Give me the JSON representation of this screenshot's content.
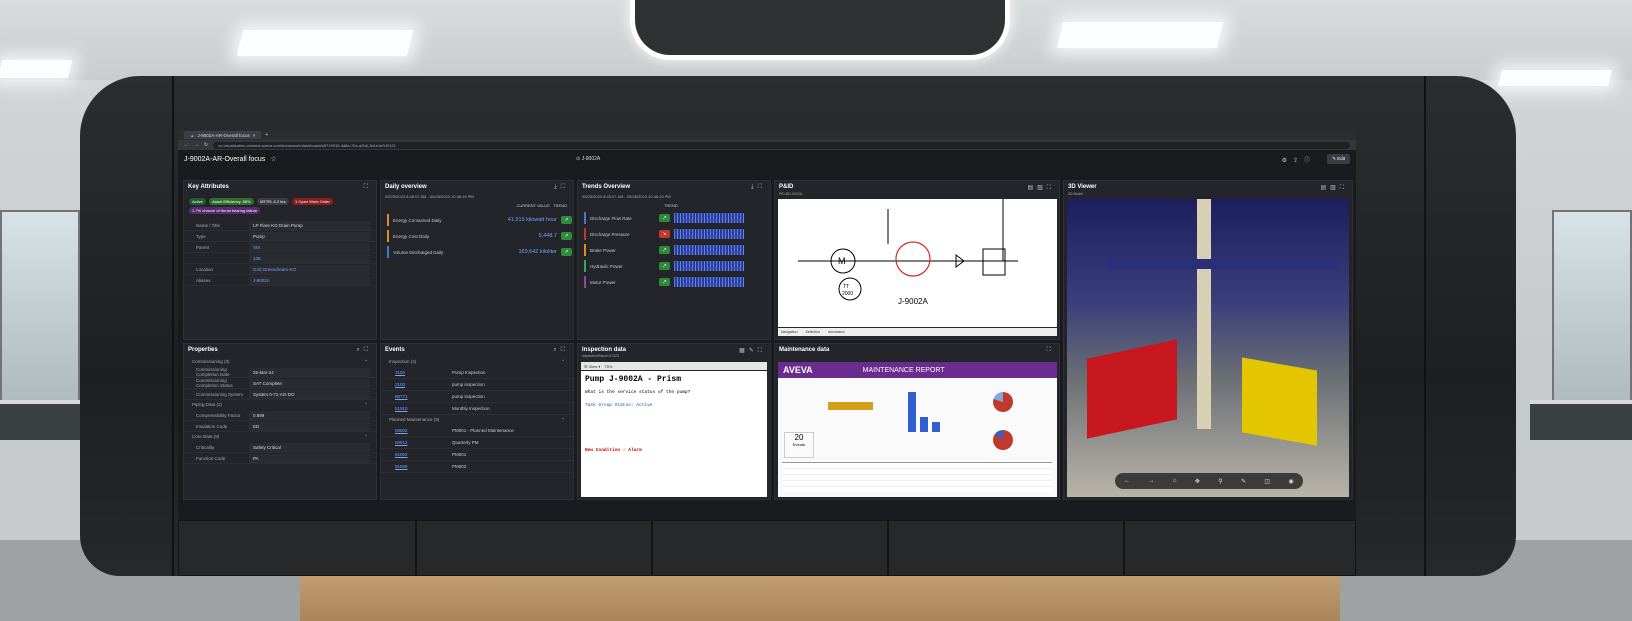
{
  "browser": {
    "tab_title": "J-9002A-AR-Overall focus",
    "url": "vo.visualization.connect.aveva.com/homework/dashboard/a5719910-4d8a-70a-a2b6-3a1e1e049121"
  },
  "header": {
    "title": "J-9002A-AR-Overall focus",
    "center": "J-9002A",
    "edit_label": "Edit",
    "icons": [
      "settings-icon",
      "share-icon",
      "info-icon"
    ]
  },
  "key_attributes": {
    "title": "Key Attributes",
    "badges": [
      "Active",
      "Asset Efficiency: 88%",
      "MTTR: 4.2 hrs",
      "1 Open Work Order"
    ],
    "warning": "1.7% chance of thrust bearing failure",
    "rows": [
      {
        "k": "Name / Title",
        "v": "LP Flare KO Drain Pump"
      },
      {
        "k": "Type",
        "v": "Pump"
      },
      {
        "k": "Parent",
        "v": "SM"
      },
      {
        "k": "",
        "v": "136"
      },
      {
        "k": "Location",
        "v": "Grid Greendream-KO"
      },
      {
        "k": "Aliases",
        "v": "J-9002A"
      }
    ]
  },
  "daily_overview": {
    "title": "Daily overview",
    "range": "05/25/2023 8:45:07 AM - 05/26/2023 10:48:19 PM",
    "col_value": "CURRENT VALUE",
    "col_trend": "TREND",
    "kpis": [
      {
        "label": "Energy Consumed Daily",
        "value": "41,913 kilowatt hour",
        "color": "#e08a2c"
      },
      {
        "label": "Energy Cost Daily",
        "value": "5,448.7",
        "color": "#e08a2c"
      },
      {
        "label": "Volume Discharged Daily",
        "value": "169,642 kiloliter",
        "color": "#3a7bd5"
      }
    ]
  },
  "trends": {
    "title": "Trends Overview",
    "range": "05/25/2023 8:45:07 AM - 05/26/2023 10:48:19 PM",
    "col_trend": "TREND",
    "items": [
      {
        "label": "Discharge Flow Rate",
        "color": "#3a7bd5",
        "status": "up"
      },
      {
        "label": "Discharge Pressure",
        "color": "#c0392b",
        "status": "down"
      },
      {
        "label": "Brake Power",
        "color": "#e08a2c",
        "status": "up"
      },
      {
        "label": "Hydraulic Power",
        "color": "#27ae60",
        "status": "up"
      },
      {
        "label": "Motor Power",
        "color": "#8e44ad",
        "status": "up"
      }
    ]
  },
  "pid": {
    "title": "P&ID",
    "subtitle": "PID-BD-9002A",
    "pump_label": "J-9002A",
    "motor": "M",
    "tag": "TT\n2000",
    "toolbar": [
      "Navigation",
      "Selection",
      "Annotation"
    ]
  },
  "viewer": {
    "title": "3D Viewer",
    "subtitle": "3D Model"
  },
  "properties": {
    "title": "Properties",
    "sections": [
      {
        "name": "Commissioning (3)",
        "rows": [
          {
            "k": "Commissioning Completion Date",
            "v": "25-Mar-24"
          },
          {
            "k": "Commissioning Completion Status",
            "v": "SAT Complete"
          },
          {
            "k": "Commissioning System",
            "v": "System 0-71-AO-DO"
          }
        ]
      },
      {
        "name": "Piping Data (2)",
        "rows": [
          {
            "k": "Compressibility Factor",
            "v": "0.899"
          },
          {
            "k": "Insulation Code",
            "v": "ED"
          }
        ]
      },
      {
        "name": "Core Data (9)",
        "rows": [
          {
            "k": "Criticality",
            "v": "Safety Critical"
          },
          {
            "k": "Function Code",
            "v": "PA"
          }
        ]
      }
    ]
  },
  "events": {
    "title": "Events",
    "sections": [
      {
        "name": "Inspection (4)",
        "items": [
          {
            "id": "3100",
            "label": "Pump Inspection"
          },
          {
            "id": "2100",
            "label": "pump inspection"
          },
          {
            "id": "86771",
            "label": "pump inspection"
          },
          {
            "id": "51910",
            "label": "Monthly Inspection"
          }
        ]
      },
      {
        "name": "Planned Maintenance (9)",
        "items": [
          {
            "id": "08602",
            "label": "PM001 - Planned Maintenance"
          },
          {
            "id": "00912",
            "label": "Quarterly PM"
          },
          {
            "id": "61002",
            "label": "PM001"
          },
          {
            "id": "91599",
            "label": "PM002"
          }
        ]
      }
    ]
  },
  "inspection": {
    "title": "Inspection data",
    "subtitle": "InspectionReport 67322",
    "zoom": "75%",
    "doc_title": "Pump J-9002A - Prism",
    "q": "What is the service status of the pump?",
    "status": "Task Group Status: Active",
    "alarm": "New Condition : Alarm"
  },
  "maintenance": {
    "title": "Maintenance data",
    "logo": "AVEVA",
    "report": "MAINTENANCE REPORT",
    "count": "20",
    "count_label": "Events"
  }
}
